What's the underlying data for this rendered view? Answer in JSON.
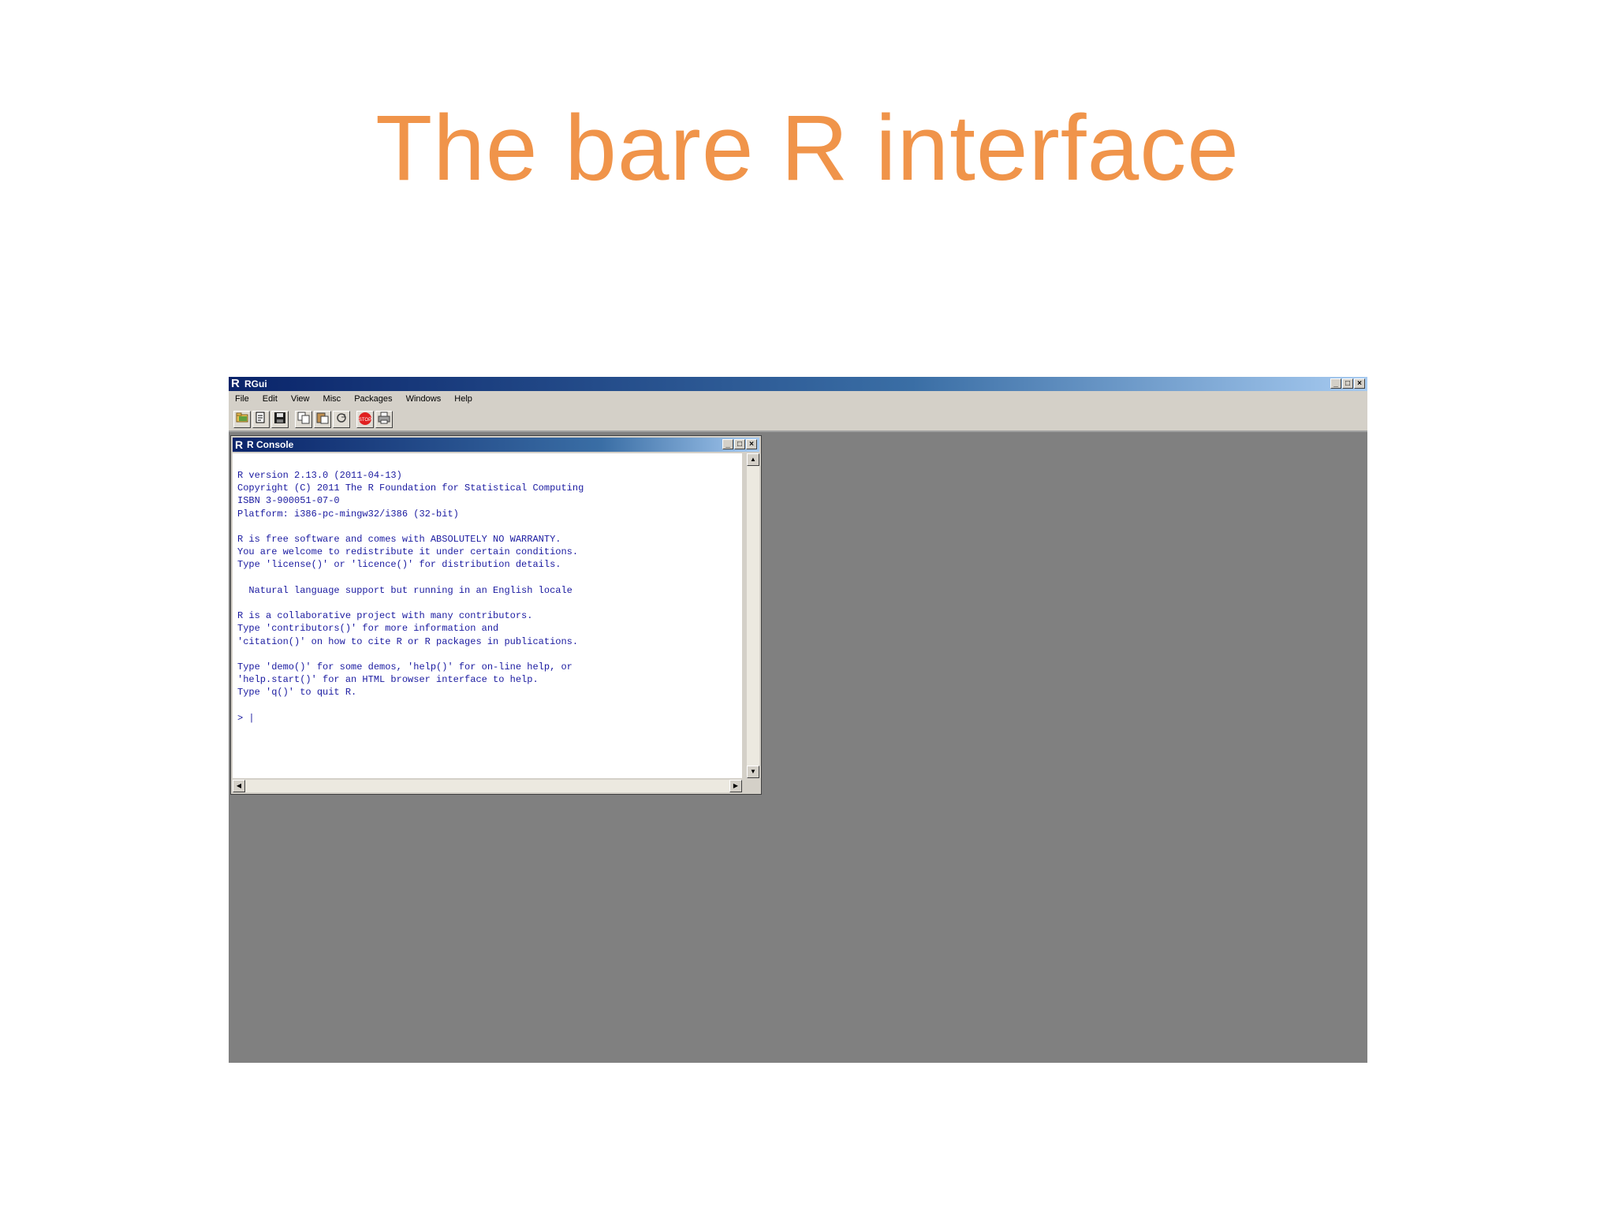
{
  "slide": {
    "title": "The bare R interface"
  },
  "rgui": {
    "title": "RGui",
    "window_buttons": [
      "_",
      "□",
      "×"
    ],
    "menu": [
      "File",
      "Edit",
      "View",
      "Misc",
      "Packages",
      "Windows",
      "Help"
    ],
    "toolbar_icons": [
      "open-script-icon",
      "load-workspace-icon",
      "save-workspace-icon",
      "copy-icon",
      "paste-icon",
      "copy-paste-icon",
      "stop-icon",
      "print-icon"
    ]
  },
  "console": {
    "title": "R Console",
    "window_buttons": [
      "_",
      "□",
      "×"
    ],
    "text": "R version 2.13.0 (2011-04-13)\nCopyright (C) 2011 The R Foundation for Statistical Computing\nISBN 3-900051-07-0\nPlatform: i386-pc-mingw32/i386 (32-bit)\n\nR is free software and comes with ABSOLUTELY NO WARRANTY.\nYou are welcome to redistribute it under certain conditions.\nType 'license()' or 'licence()' for distribution details.\n\n  Natural language support but running in an English locale\n\nR is a collaborative project with many contributors.\nType 'contributors()' for more information and\n'citation()' on how to cite R or R packages in publications.\n\nType 'demo()' for some demos, 'help()' for on-line help, or\n'help.start()' for an HTML browser interface to help.\nType 'q()' to quit R.\n\n> |"
  }
}
